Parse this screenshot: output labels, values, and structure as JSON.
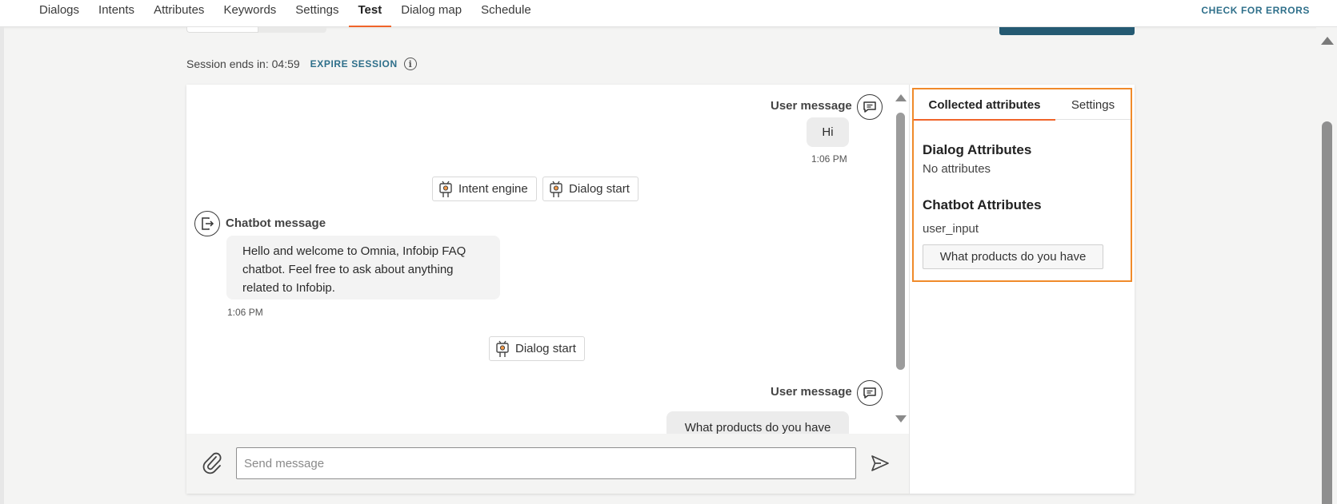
{
  "nav": {
    "tabs": [
      {
        "label": "Dialogs"
      },
      {
        "label": "Intents"
      },
      {
        "label": "Attributes"
      },
      {
        "label": "Keywords"
      },
      {
        "label": "Settings"
      },
      {
        "label": "Test"
      },
      {
        "label": "Dialog map"
      },
      {
        "label": "Schedule"
      }
    ],
    "active_tab": "Test",
    "check_errors": "CHECK FOR ERRORS"
  },
  "session": {
    "label": "Session ends in: 04:59",
    "expire": "EXPIRE SESSION",
    "info_icon": "i"
  },
  "chat": {
    "messages": [
      {
        "label": "User message",
        "text": "Hi",
        "time": "1:06 PM"
      },
      {
        "label": "Chatbot message",
        "text": "Hello and welcome to Omnia, Infobip FAQ chatbot. Feel free to ask about anything related to Infobip.",
        "time": "1:06 PM"
      },
      {
        "label": "User message",
        "text": "What products do you have"
      }
    ],
    "events": {
      "intent_engine": "Intent engine",
      "dialog_start_1": "Dialog start",
      "dialog_start_2": "Dialog start"
    },
    "input_placeholder": "Send message"
  },
  "panel": {
    "tabs": {
      "collected": "Collected attributes",
      "settings": "Settings"
    },
    "dialog_attributes": {
      "title": "Dialog Attributes",
      "empty": "No attributes"
    },
    "chatbot_attributes": {
      "title": "Chatbot Attributes",
      "name": "user_input",
      "value": "What products do you have"
    }
  },
  "colors": {
    "accent": "#f0642a",
    "highlight": "#f08a2a",
    "link": "#2e6f8a",
    "primary_button": "#255a72"
  },
  "icons": [
    "paperclip-icon",
    "send-icon",
    "chat-bubble-icon",
    "exit-icon",
    "robot-icon",
    "info-icon",
    "scroll-up-icon",
    "scroll-down-icon"
  ]
}
